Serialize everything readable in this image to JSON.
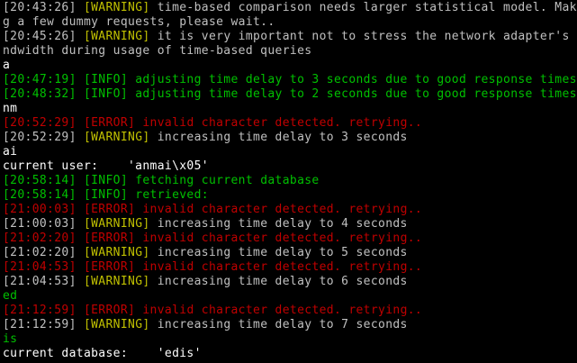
{
  "terminal": {
    "colors": {
      "background": "#000000",
      "gray": "#c0c0c0",
      "white": "#ffffff",
      "green": "#00c000",
      "red": "#c00000",
      "yellow": "#c0c000"
    },
    "lines": [
      [
        {
          "t": "[20:43:26] ",
          "c": "gray"
        },
        {
          "t": "[WARNING]",
          "c": "yellow"
        },
        {
          "t": " time-based comparison needs larger statistical model. Makin",
          "c": "gray"
        }
      ],
      [
        {
          "t": "g a few dummy requests, please wait..",
          "c": "gray"
        }
      ],
      [
        {
          "t": "[20:45:26] ",
          "c": "gray"
        },
        {
          "t": "[WARNING]",
          "c": "yellow"
        },
        {
          "t": " it is very important not to stress the network adapter's ba",
          "c": "gray"
        }
      ],
      [
        {
          "t": "ndwidth during usage of time-based queries",
          "c": "gray"
        }
      ],
      [
        {
          "t": "a",
          "c": "white"
        }
      ],
      [
        {
          "t": "[20:47:19] ",
          "c": "green"
        },
        {
          "t": "[INFO]",
          "c": "green"
        },
        {
          "t": " adjusting time delay to 3 seconds due to good response times",
          "c": "green"
        }
      ],
      [
        {
          "t": "[20:48:32] ",
          "c": "green"
        },
        {
          "t": "[INFO]",
          "c": "green"
        },
        {
          "t": " adjusting time delay to 2 seconds due to good response times",
          "c": "green"
        }
      ],
      [
        {
          "t": "nm",
          "c": "white"
        }
      ],
      [
        {
          "t": "[20:52:29] ",
          "c": "red"
        },
        {
          "t": "[ERROR]",
          "c": "red"
        },
        {
          "t": " invalid character detected. retrying..",
          "c": "red"
        }
      ],
      [
        {
          "t": "[20:52:29] ",
          "c": "gray"
        },
        {
          "t": "[WARNING]",
          "c": "yellow"
        },
        {
          "t": " increasing time delay to 3 seconds",
          "c": "gray"
        }
      ],
      [
        {
          "t": "ai",
          "c": "white"
        }
      ],
      [
        {
          "t": "current user:    'anmai\\x05'",
          "c": "white"
        }
      ],
      [
        {
          "t": "[20:58:14] ",
          "c": "green"
        },
        {
          "t": "[INFO]",
          "c": "green"
        },
        {
          "t": " fetching current database",
          "c": "green"
        }
      ],
      [
        {
          "t": "[20:58:14] ",
          "c": "green"
        },
        {
          "t": "[INFO]",
          "c": "green"
        },
        {
          "t": " retrieved:",
          "c": "green"
        }
      ],
      [
        {
          "t": "[21:00:03] ",
          "c": "red"
        },
        {
          "t": "[ERROR]",
          "c": "red"
        },
        {
          "t": " invalid character detected. retrying..",
          "c": "red"
        }
      ],
      [
        {
          "t": "[21:00:03] ",
          "c": "gray"
        },
        {
          "t": "[WARNING]",
          "c": "yellow"
        },
        {
          "t": " increasing time delay to 4 seconds",
          "c": "gray"
        }
      ],
      [
        {
          "t": "[21:02:20] ",
          "c": "red"
        },
        {
          "t": "[ERROR]",
          "c": "red"
        },
        {
          "t": " invalid character detected. retrying..",
          "c": "red"
        }
      ],
      [
        {
          "t": "[21:02:20] ",
          "c": "gray"
        },
        {
          "t": "[WARNING]",
          "c": "yellow"
        },
        {
          "t": " increasing time delay to 5 seconds",
          "c": "gray"
        }
      ],
      [
        {
          "t": "[21:04:53] ",
          "c": "red"
        },
        {
          "t": "[ERROR]",
          "c": "red"
        },
        {
          "t": " invalid character detected. retrying..",
          "c": "red"
        }
      ],
      [
        {
          "t": "[21:04:53] ",
          "c": "gray"
        },
        {
          "t": "[WARNING]",
          "c": "yellow"
        },
        {
          "t": " increasing time delay to 6 seconds",
          "c": "gray"
        }
      ],
      [
        {
          "t": "ed",
          "c": "green"
        }
      ],
      [
        {
          "t": "[21:12:59] ",
          "c": "red"
        },
        {
          "t": "[ERROR]",
          "c": "red"
        },
        {
          "t": " invalid character detected. retrying..",
          "c": "red"
        }
      ],
      [
        {
          "t": "[21:12:59] ",
          "c": "gray"
        },
        {
          "t": "[WARNING]",
          "c": "yellow"
        },
        {
          "t": " increasing time delay to 7 seconds",
          "c": "gray"
        }
      ],
      [
        {
          "t": "is",
          "c": "green"
        }
      ],
      [
        {
          "t": "current database:    'edis'",
          "c": "white"
        }
      ]
    ]
  }
}
